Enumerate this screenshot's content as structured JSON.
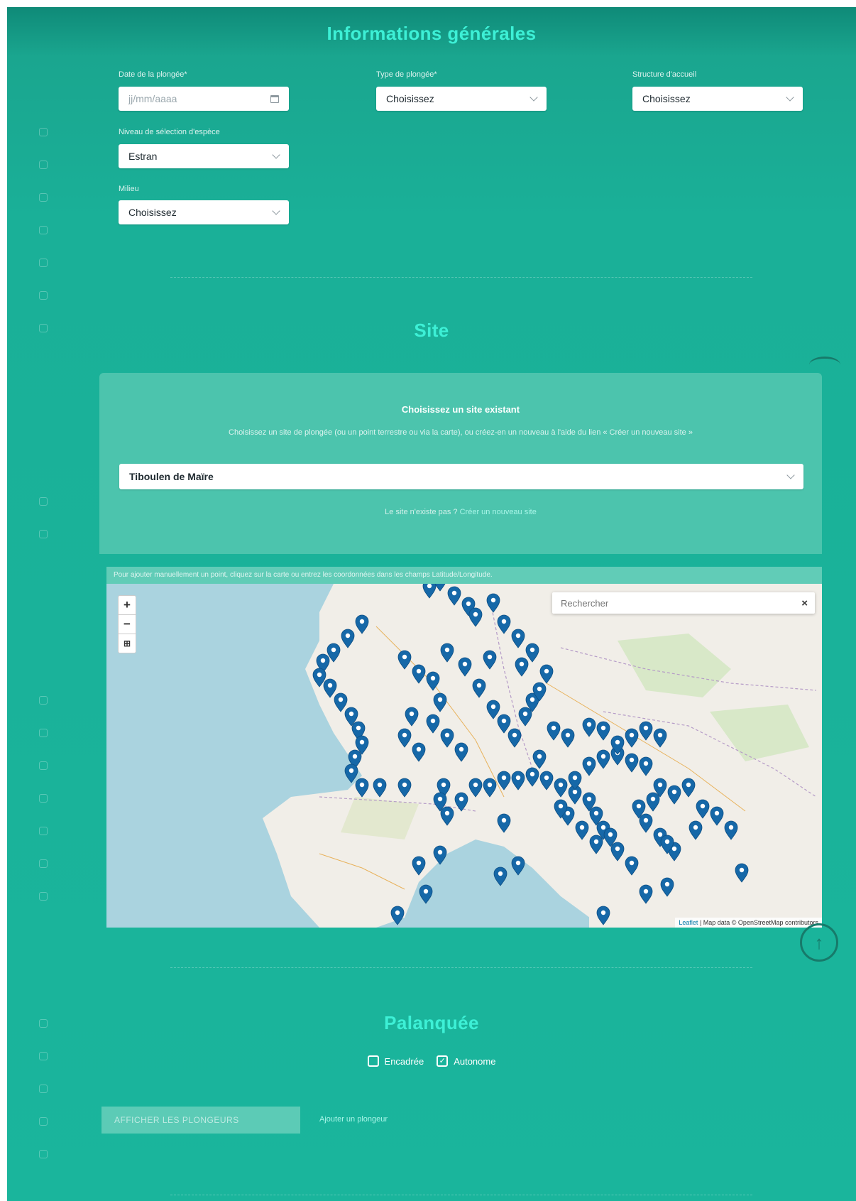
{
  "sections": {
    "general": "Informations générales",
    "site": "Site",
    "palanquee": "Palanquée"
  },
  "general": {
    "date_label": "Date de la plongée*",
    "date_placeholder": "jj/mm/aaaa",
    "type_label": "Type de plongée*",
    "type_value": "Choisissez",
    "structure_label": "Structure d'accueil",
    "structure_value": "Choisissez",
    "niveau_label": "Niveau de sélection d'espèce",
    "niveau_value": "Estran",
    "milieu_label": "Milieu",
    "milieu_value": "Choisissez"
  },
  "site": {
    "heading": "Choisissez un site existant",
    "help": "Choisissez un site de plongée (ou un point terrestre ou via la carte), ou créez-en un nouveau à l'aide du lien « Créer un nouveau site »",
    "selected_site": "Tiboulen de Maïre",
    "missing_prefix": "Le site n'existe pas ?",
    "missing_link": "Créer un nouveau site",
    "map_note": "Pour ajouter manuellement un point, cliquez sur la carte ou entrez les coordonnées dans les champs Latitude/Longitude.",
    "map_search_placeholder": "Rechercher",
    "map_search_clear": "×",
    "zoom_in": "+",
    "zoom_out": "−",
    "layers": "⊞",
    "attribution_leaflet": "Leaflet",
    "attribution_text": "| Map data © OpenStreetMap contributors"
  },
  "palanquee": {
    "encadree_label": "Encadrée",
    "autonome_label": "Autonome",
    "encadree_checked": false,
    "autonome_checked": true,
    "add_button": "AFFICHER LES PLONGEURS",
    "add_link": "Ajouter un plongeur"
  },
  "scroll_top_icon": "arrow-up-icon",
  "colors": {
    "accent": "#3df0d6",
    "marker": "#1668a8",
    "panel": "#4cc4ad"
  }
}
